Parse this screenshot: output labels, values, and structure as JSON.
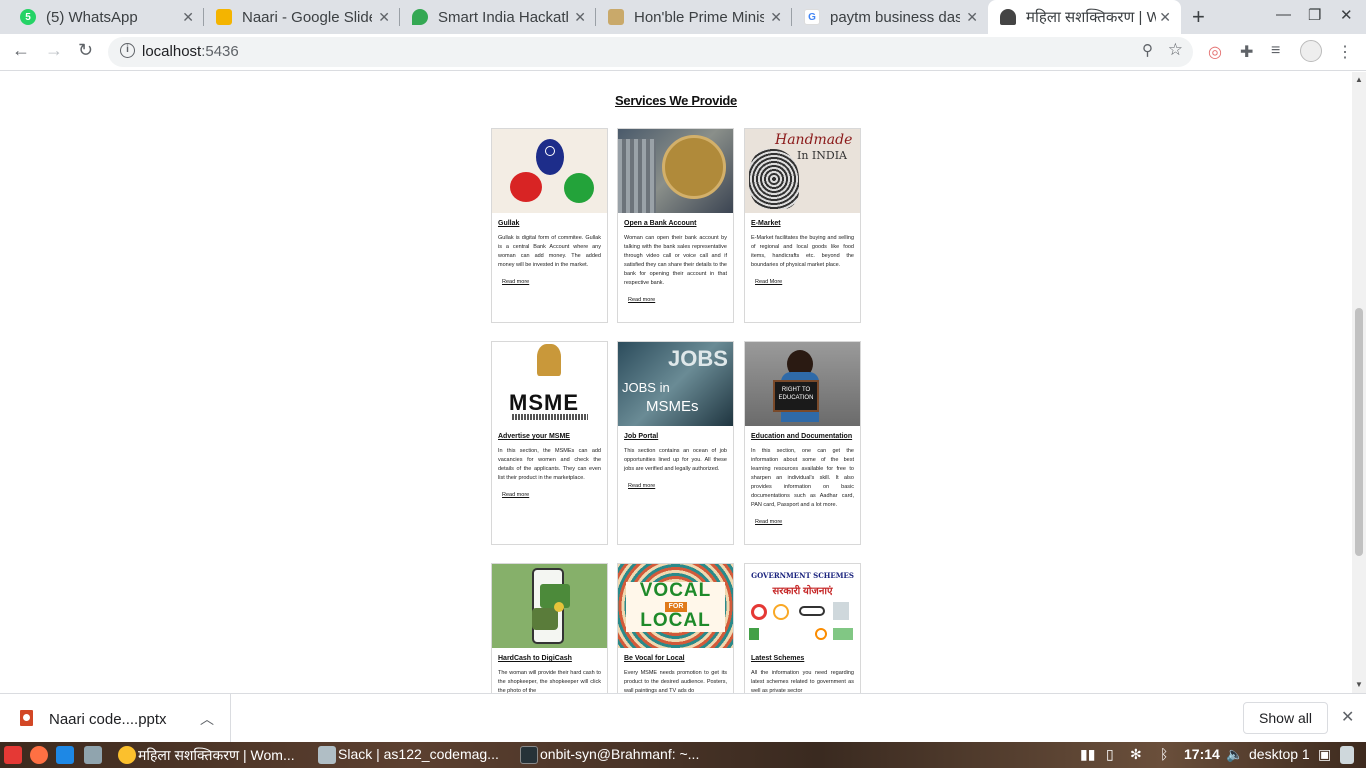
{
  "browser": {
    "tabs": [
      {
        "title": "(5) WhatsApp",
        "icon": "whatsapp-icon",
        "color": "#25d366",
        "badge": "5"
      },
      {
        "title": "Naari - Google Slides",
        "icon": "slides-icon",
        "color": "#f4b400",
        "badge": ""
      },
      {
        "title": "Smart India Hackathon",
        "icon": "map-pin-icon",
        "color": "#34a853",
        "badge": ""
      },
      {
        "title": "Hon'ble Prime Minister",
        "icon": "emblem-icon",
        "color": "#c9a96a",
        "badge": ""
      },
      {
        "title": "paytm business dashboard",
        "icon": "google-icon",
        "color": "#4285f4",
        "badge": "G"
      },
      {
        "title": "महिला सशक्तिकरण | Women",
        "icon": "woman-icon",
        "color": "#444444",
        "badge": ""
      }
    ],
    "url_host": "localhost",
    "url_port": ":5436"
  },
  "page": {
    "heading": "Services We Provide",
    "cards": [
      {
        "title": "Gullak",
        "text": "Gullak is digital form of commitee. Gullak is a central Bank Account where any woman can add money. The added money will be invested in the market.",
        "more": "Read more",
        "image": "piggy-bank-image"
      },
      {
        "title": "Open a Bank Account",
        "text": "Woman can open their bank account by talking with the bank sales representative through video call or voice call and if satisfied they can share their details to the bank for opening their account in that respective bank.",
        "more": "Read more",
        "image": "rbi-emblem-image"
      },
      {
        "title": "E-Market",
        "text": "E-Market facilitates the buying and selling of regional and local goods like food items, handicrafts etc. beyond the boundaries of physical market place.",
        "more": "Read More",
        "image": "handmade-in-india-image"
      },
      {
        "title": "Advertise your MSME",
        "text": "In this section, the MSMEs can add vacancies for women and check the details of the applicants. They can even list their product in the marketplace.",
        "more": "Read more",
        "image": "msme-logo-image"
      },
      {
        "title": "Job Portal",
        "text": "This section contains an ocean of job opportunities lined up for you. All these jobs are verified and legally authorized.",
        "more": "Read more",
        "image": "jobs-in-msmes-image"
      },
      {
        "title": "Education and Documentation",
        "text": "In this section, one can get the information about some of the best learning resources available for free to sharpen an individual's skill. It also provides information on basic documentations such as Aadhar card, PAN card, Passport and a lot more.",
        "more": "Read more",
        "image": "right-to-education-image"
      },
      {
        "title": "HardCash to DigiCash",
        "text": "The woman will provide their hard cash to the shopkeeper, the shopkeeper will click the photo of the",
        "more": "",
        "image": "digital-wallet-image"
      },
      {
        "title": "Be Vocal for Local",
        "text": "Every MSME needs promotion to get its product to the desired audience. Posters, wall paintings and TV ads do",
        "more": "",
        "image": "vocal-for-local-image"
      },
      {
        "title": "Latest Schemes",
        "text": "All the information you need regarding latest schemes related to government as well as private sector",
        "more": "",
        "image": "government-schemes-image"
      }
    ],
    "img_text": {
      "handmade": "Handmade",
      "in_india": "In INDIA",
      "msme": "MSME",
      "jobs": "JOBS",
      "jobs_in": "JOBS in",
      "msmes": "MSMEs",
      "right_to_education": "RIGHT TO EDUCATION",
      "vocal": "VOCAL",
      "for": "FOR",
      "local": "LOCAL",
      "gov_schemes": "GOVERNMENT SCHEMES",
      "sarkari": "सरकारी योजनाएं"
    }
  },
  "downloads": {
    "file_name": "Naari code....pptx",
    "show_all": "Show all"
  },
  "taskbar": {
    "items": [
      {
        "label": "महिला सशक्तिकरण | Wom..."
      },
      {
        "label": "Slack | as122_codemag..."
      },
      {
        "label": "onbit-syn@Brahmanf: ~..."
      }
    ],
    "time": "17:14",
    "desktop": "desktop 1"
  }
}
